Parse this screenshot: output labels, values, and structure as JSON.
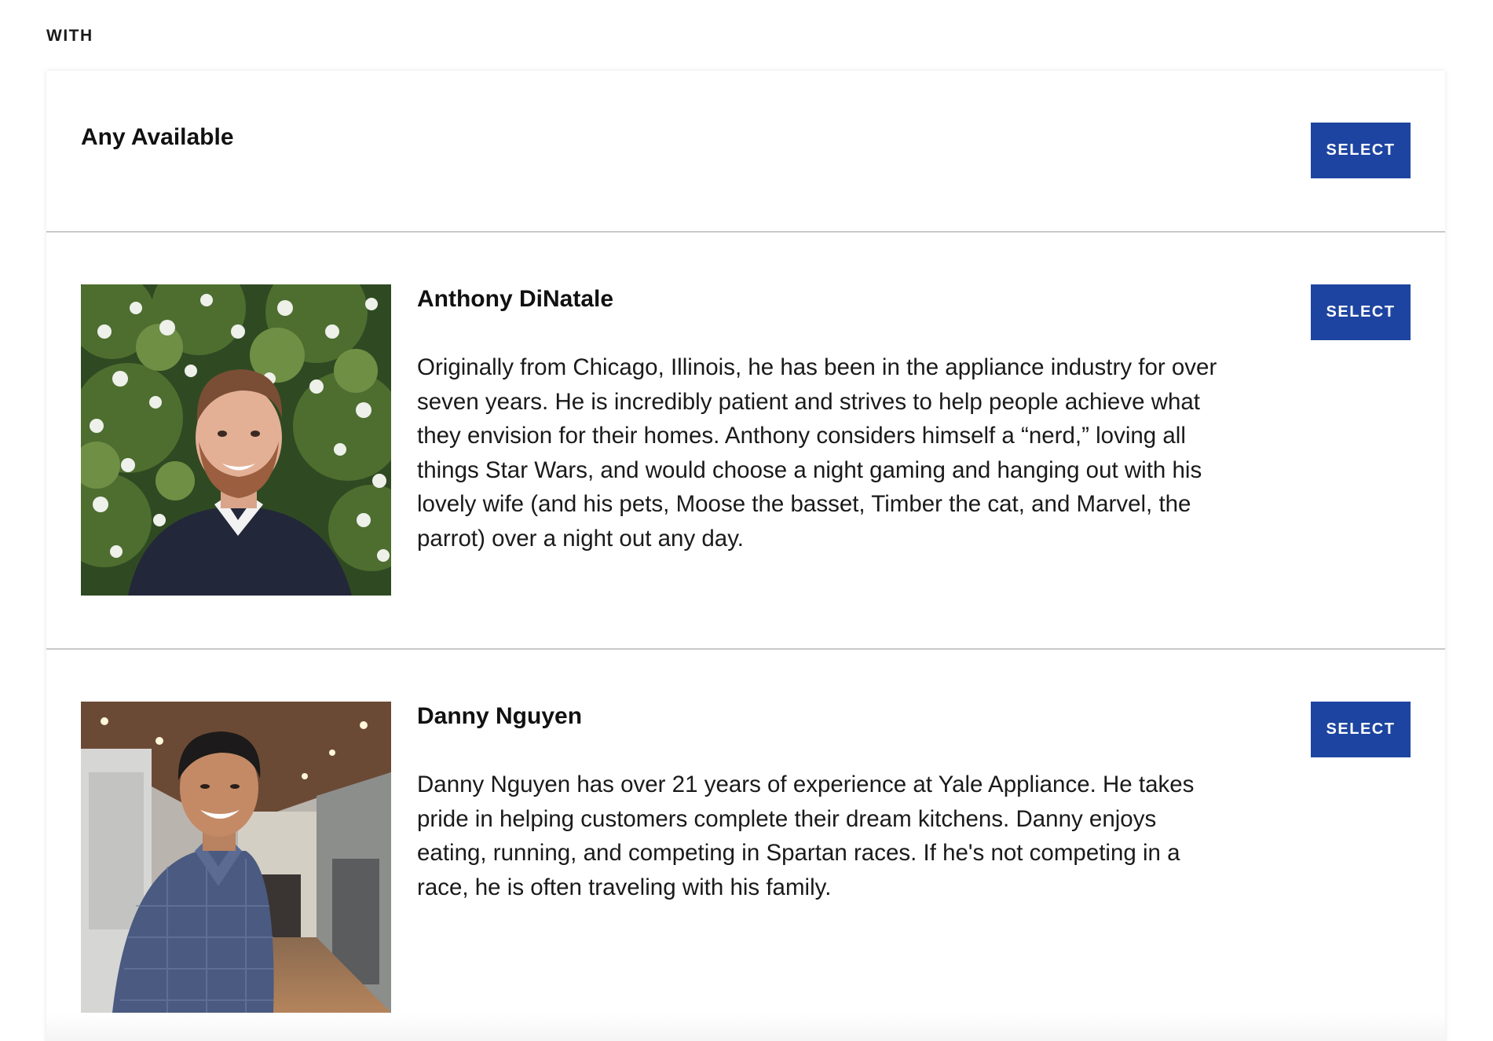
{
  "section_label": "WITH",
  "any_available": {
    "name": "Any Available",
    "button_label": "SELECT"
  },
  "staff": [
    {
      "name": "Anthony DiNatale",
      "bio": "Originally from Chicago, Illinois, he has been in the appliance industry for over seven years. He is incredibly patient and strives to help people achieve what they envision for their homes. Anthony considers himself a “nerd,” loving all things Star Wars, and would choose a night gaming and hanging out with his lovely wife (and his pets, Moose the basset, Timber the cat, and Marvel, the parrot) over a night out any day.",
      "button_label": "SELECT"
    },
    {
      "name": "Danny Nguyen",
      "bio": "Danny Nguyen has over 21 years of experience at Yale Appliance. He takes pride in helping customers complete their dream kitchens. Danny enjoys eating, running, and competing in Spartan races. If he's not competing in a race, he is often traveling with his family.",
      "button_label": "SELECT"
    }
  ],
  "colors": {
    "button_bg": "#1d44a0",
    "button_text": "#ffffff",
    "divider": "#c9c9c9"
  }
}
